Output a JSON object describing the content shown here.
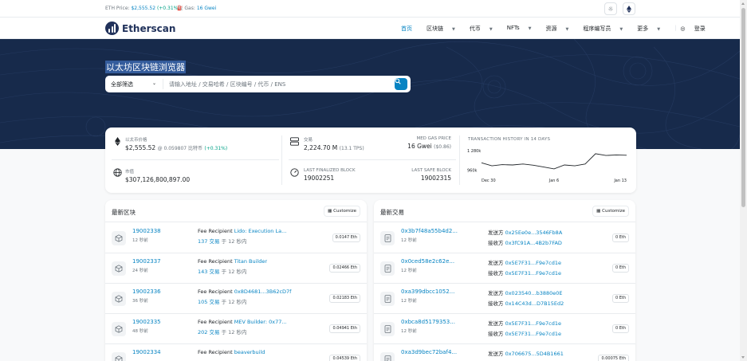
{
  "topbar": {
    "eth_price_label": "ETH Price:",
    "eth_price_value": "$2,555.52",
    "eth_price_change": "(+0.31%)",
    "gas_label": "Gas:",
    "gas_value": "16 Gwei"
  },
  "nav": {
    "brand": "Etherscan",
    "items": [
      {
        "label": "首页",
        "active": true,
        "dropdown": false
      },
      {
        "label": "区块链",
        "dropdown": true
      },
      {
        "label": "代币",
        "dropdown": true
      },
      {
        "label": "NFTs",
        "dropdown": true
      },
      {
        "label": "资源",
        "dropdown": true
      },
      {
        "label": "程序编写员",
        "dropdown": true
      },
      {
        "label": "更多",
        "dropdown": true
      }
    ],
    "login": "登录"
  },
  "hero": {
    "title": "以太坊区块链浏览器",
    "filter": "全部筛选",
    "search_placeholder": "请输入地址 / 交易哈希 / 区块编号 / 代币 / ENS"
  },
  "stats": {
    "ether_price_label": "以太币价格",
    "ether_price_value": "$2,555.52",
    "ether_price_btc": "@ 0.059807 比特币",
    "ether_price_change": "(+0.31%)",
    "tx_label": "交易",
    "tx_value": "2,224.70 M",
    "tx_tps": "(13.1 TPS)",
    "gas_label": "MED GAS PRICE",
    "gas_value": "16 Gwei",
    "gas_usd": "($0.86)",
    "mcap_label": "市值",
    "mcap_value": "$307,126,800,897.00",
    "finalized_label": "LAST FINALIZED BLOCK",
    "finalized_value": "19002251",
    "safe_label": "LAST SAFE BLOCK",
    "safe_value": "19002315",
    "chart_title": "TRANSACTION HISTORY IN 14 DAYS"
  },
  "chart_data": {
    "type": "line",
    "title": "TRANSACTION HISTORY IN 14 DAYS",
    "x": [
      "Dec 30",
      "Dec 31",
      "Jan 1",
      "Jan 2",
      "Jan 3",
      "Jan 4",
      "Jan 5",
      "Jan 6",
      "Jan 7",
      "Jan 8",
      "Jan 9",
      "Jan 10",
      "Jan 11",
      "Jan 12",
      "Jan 13"
    ],
    "x_tick_labels": [
      "Dec 30",
      "Jan 6",
      "Jan 13"
    ],
    "y_tick_labels": [
      "1 280k",
      "960k"
    ],
    "series": [
      {
        "values": [
          1080000,
          1030000,
          1050000,
          1045000,
          1060000,
          1040000,
          1010000,
          980000,
          1045000,
          1030000,
          1060000,
          1230000,
          1200000,
          1210000,
          1205000
        ]
      }
    ],
    "ylim": [
      900000,
      1320000
    ],
    "grid": false,
    "line_color": "#212529"
  },
  "latest_blocks": {
    "title": "最新区块",
    "customize": "Customize",
    "fee_label": "Fee Recipient",
    "items": [
      {
        "block": "19002338",
        "age": "12 秒前",
        "recipient": "Lido: Execution La...",
        "txns": "137 交易",
        "txn_time": "于 12 秒内",
        "reward": "0.0147 Eth"
      },
      {
        "block": "19002337",
        "age": "24 秒前",
        "recipient": "Titan Builder",
        "txns": "143 交易",
        "txn_time": "于 12 秒内",
        "reward": "0.02466 Eth"
      },
      {
        "block": "19002336",
        "age": "36 秒前",
        "recipient": "0x8D4681...3B62cD7f",
        "txns": "105 交易",
        "txn_time": "于 12 秒内",
        "reward": "0.02183 Eth"
      },
      {
        "block": "19002335",
        "age": "48 秒前",
        "recipient": "MEV Builder: 0x77...",
        "txns": "202 交易",
        "txn_time": "于 12 秒内",
        "reward": "0.04941 Eth"
      },
      {
        "block": "19002334",
        "age": "",
        "recipient": "beaverbuild",
        "txns": "",
        "txn_time": "",
        "reward": "0.04539 Eth"
      }
    ]
  },
  "latest_txns": {
    "title": "最新交易",
    "customize": "Customize",
    "from_label": "发送方",
    "to_label": "接收方",
    "items": [
      {
        "hash": "0x3b7f48a55b4d2...",
        "age": "12 秒前",
        "from": "0x25Ee0e...3546Fb8A",
        "to": "0x3fC91A...4B2b7FAD",
        "amount": "0 Eth"
      },
      {
        "hash": "0x0ced58e2c62e...",
        "age": "12 秒前",
        "from": "0x5E7F31...F9e7cd1e",
        "to": "0x5E7F31...F9e7cd1e",
        "amount": "0 Eth"
      },
      {
        "hash": "0xa399dbcc1052...",
        "age": "12 秒前",
        "from": "0x023540...b3880e0E",
        "to": "0x14C43d...D7B15Ed2",
        "amount": "0 Eth"
      },
      {
        "hash": "0xbca8d5179353...",
        "age": "12 秒前",
        "from": "0x5E7F31...F9e7cd1e",
        "to": "0x5E7F31...F9e7cd1e",
        "amount": "0 Eth"
      },
      {
        "hash": "0xa3d9bec72baf4...",
        "age": "",
        "from": "0x706675...5D4B1661",
        "to": "",
        "amount": "0.00075 Eth"
      }
    ]
  },
  "colors": {
    "hero_bg": "#172a4b",
    "link": "#0784c3",
    "positive": "#00a186",
    "brand": "#21325b"
  }
}
